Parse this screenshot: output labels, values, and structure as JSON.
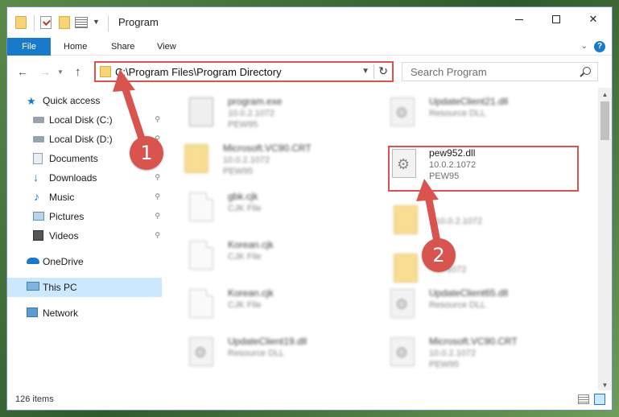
{
  "window": {
    "title": "Program",
    "controls": {
      "minimize": "—",
      "maximize": "☐",
      "close": "✕"
    }
  },
  "ribbon": {
    "tabs": [
      "File",
      "Home",
      "Share",
      "View"
    ],
    "help": "?",
    "collapse": "⌄"
  },
  "nav": {
    "back": "←",
    "forward": "→",
    "recent": "⌄",
    "up": "↑"
  },
  "address": {
    "path": "C:\\Program Files\\Program Directory",
    "dropdown": "⌄",
    "refresh": "↻"
  },
  "search": {
    "placeholder": "Search Program"
  },
  "sidebar": {
    "items": [
      {
        "label": "Quick access",
        "icon": "star-icon",
        "pinned": false
      },
      {
        "label": "Local Disk (C:)",
        "icon": "disk-icon",
        "pinned": true
      },
      {
        "label": "Local Disk (D:)",
        "icon": "disk-icon",
        "pinned": true
      },
      {
        "label": "Documents",
        "icon": "documents-icon",
        "pinned": true
      },
      {
        "label": "Downloads",
        "icon": "downloads-icon",
        "pinned": true
      },
      {
        "label": "Music",
        "icon": "music-icon",
        "pinned": true
      },
      {
        "label": "Pictures",
        "icon": "pictures-icon",
        "pinned": true
      },
      {
        "label": "Videos",
        "icon": "videos-icon",
        "pinned": true
      },
      {
        "label": "OneDrive",
        "icon": "onedrive-icon",
        "pinned": false
      },
      {
        "label": "This PC",
        "icon": "computer-icon",
        "pinned": false,
        "selected": true
      },
      {
        "label": "Network",
        "icon": "network-icon",
        "pinned": false
      }
    ],
    "pin_glyph": "📌"
  },
  "files": {
    "left": [
      {
        "name": "program.exe",
        "line1": "10.0.2.1072",
        "line2": "PEW95",
        "kind": "exe"
      },
      {
        "name": "Microsoft.VC90.CRT",
        "line1": "10.0.2.1072",
        "line2": "PEW95",
        "kind": "folder"
      },
      {
        "name": "gbk.cjk",
        "line1": "CJK File",
        "line2": "",
        "kind": "doc"
      },
      {
        "name": "Korean.cjk",
        "line1": "CJK File",
        "line2": "",
        "kind": "doc"
      },
      {
        "name": "Korean.cjk",
        "line1": "CJK File",
        "line2": "",
        "kind": "doc"
      },
      {
        "name": "UpdateClient19.dll",
        "line1": "Resource DLL",
        "line2": "",
        "kind": "dll"
      }
    ],
    "right": [
      {
        "name": "UpdateClient21.dll",
        "line1": "Resource DLL",
        "line2": "",
        "kind": "dll"
      },
      {
        "name": "pew952.dll",
        "line1": "10.0.2.1072",
        "line2": "PEW95",
        "kind": "dll"
      },
      {
        "name": "",
        "line1": "10.0.2.1072",
        "line2": "",
        "kind": "folder"
      },
      {
        "name": "",
        "line1": "1072",
        "line2": "",
        "kind": "folder"
      },
      {
        "name": "UpdateClient65.dll",
        "line1": "Resource DLL",
        "line2": "",
        "kind": "dll"
      },
      {
        "name": "Microsoft.VC90.CRT",
        "line1": "10.0.2.1072",
        "line2": "PEW95",
        "kind": "folder"
      }
    ]
  },
  "annotations": {
    "step1": "1",
    "step2": "2",
    "color": "#d9534f"
  },
  "status": {
    "items": "126 items"
  },
  "scroll": {
    "up": "▲",
    "down": "▼"
  },
  "colors": {
    "accent": "#1979ca",
    "highlight": "#d9534f",
    "selected": "#cce8ff"
  }
}
